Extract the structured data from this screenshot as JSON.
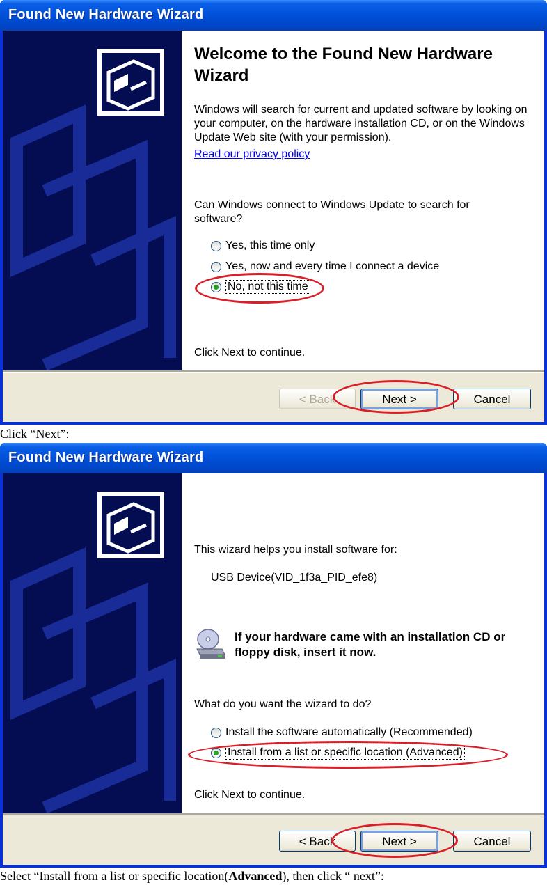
{
  "window1": {
    "title": "Found New Hardware Wizard",
    "heading": "Welcome to the Found New Hardware Wizard",
    "intro": "Windows will search for current and updated software by looking on your computer, on the hardware installation CD, or on the Windows Update Web site (with your permission).",
    "privacy_link": "Read our privacy policy",
    "question": "Can Windows connect to Windows Update to search for software?",
    "options": [
      {
        "label": "Yes, this time only",
        "selected": false
      },
      {
        "label": "Yes, now and every time I connect a device",
        "selected": false
      },
      {
        "label": "No, not this time",
        "selected": true
      }
    ],
    "footer_text": "Click Next to continue.",
    "buttons": {
      "back": "< Back",
      "next": "Next >",
      "cancel": "Cancel"
    }
  },
  "caption1": "Click “Next”:",
  "window2": {
    "title": "Found New Hardware Wizard",
    "intro": "This wizard helps you install software for:",
    "device": "USB Device(VID_1f3a_PID_efe8)",
    "cd_message": "If your hardware came with an installation CD or floppy disk, insert it now.",
    "question": "What do you want the wizard to do?",
    "options": [
      {
        "label": "Install the software automatically (Recommended)",
        "selected": false
      },
      {
        "label": "Install from a list or specific location (Advanced)",
        "selected": true
      }
    ],
    "footer_text": "Click Next to continue.",
    "buttons": {
      "back": "< Back",
      "next": "Next >",
      "cancel": "Cancel"
    }
  },
  "caption2": {
    "before": "Select “Install from a list or specific location(",
    "bold": "Advanced",
    "after": "), then click “ next”:"
  },
  "colors": {
    "annotation": "#d9202a",
    "titlebar": "#0050d8",
    "sidebar": "#040d52"
  },
  "icons": [
    "hardware-wizard-icon",
    "cd-drive-icon",
    "radio-button"
  ]
}
